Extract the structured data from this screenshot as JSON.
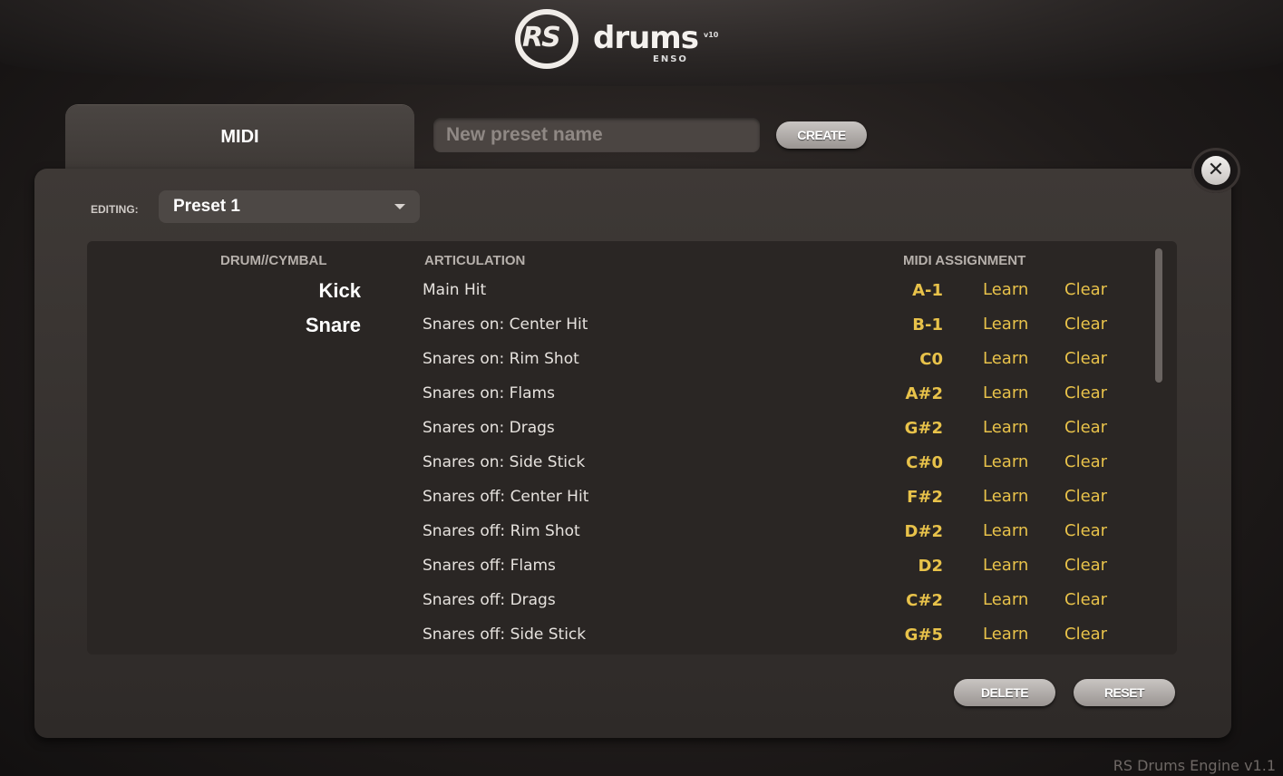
{
  "header": {
    "logo_mark": "RS",
    "logo_name": "drums",
    "logo_version": "v10",
    "logo_sub": "ENSO"
  },
  "tab": {
    "label": "MIDI"
  },
  "preset_create": {
    "placeholder": "New preset name",
    "create_label": "CREATE"
  },
  "close": {
    "icon": "close-icon",
    "glyph": "✕"
  },
  "editing": {
    "label": "EDITING:",
    "selected_preset": "Preset 1"
  },
  "table": {
    "headers": {
      "drum": "DRUM//CYMBAL",
      "articulation": "ARTICULATION",
      "midi": "MIDI ASSIGNMENT"
    },
    "learn_label": "Learn",
    "clear_label": "Clear",
    "rows": [
      {
        "drum": "Kick",
        "articulation": "Main Hit",
        "note": "A-1"
      },
      {
        "drum": "Snare",
        "articulation": "Snares on: Center Hit",
        "note": "B-1"
      },
      {
        "drum": "",
        "articulation": "Snares on: Rim Shot",
        "note": "C0"
      },
      {
        "drum": "",
        "articulation": "Snares on: Flams",
        "note": "A#2"
      },
      {
        "drum": "",
        "articulation": "Snares on: Drags",
        "note": "G#2"
      },
      {
        "drum": "",
        "articulation": "Snares on: Side Stick",
        "note": "C#0"
      },
      {
        "drum": "",
        "articulation": "Snares off: Center Hit",
        "note": "F#2"
      },
      {
        "drum": "",
        "articulation": "Snares off: Rim Shot",
        "note": "D#2"
      },
      {
        "drum": "",
        "articulation": "Snares off: Flams",
        "note": "D2"
      },
      {
        "drum": "",
        "articulation": "Snares off: Drags",
        "note": "C#2"
      },
      {
        "drum": "",
        "articulation": "Snares off: Side Stick",
        "note": "G#5"
      }
    ]
  },
  "actions": {
    "delete_label": "DELETE",
    "reset_label": "RESET"
  },
  "footer": {
    "engine": "RS Drums Engine v1.1"
  },
  "colors": {
    "accent": "#e8c24a",
    "panel": "#3a3532",
    "background": "#1f1b1a"
  }
}
